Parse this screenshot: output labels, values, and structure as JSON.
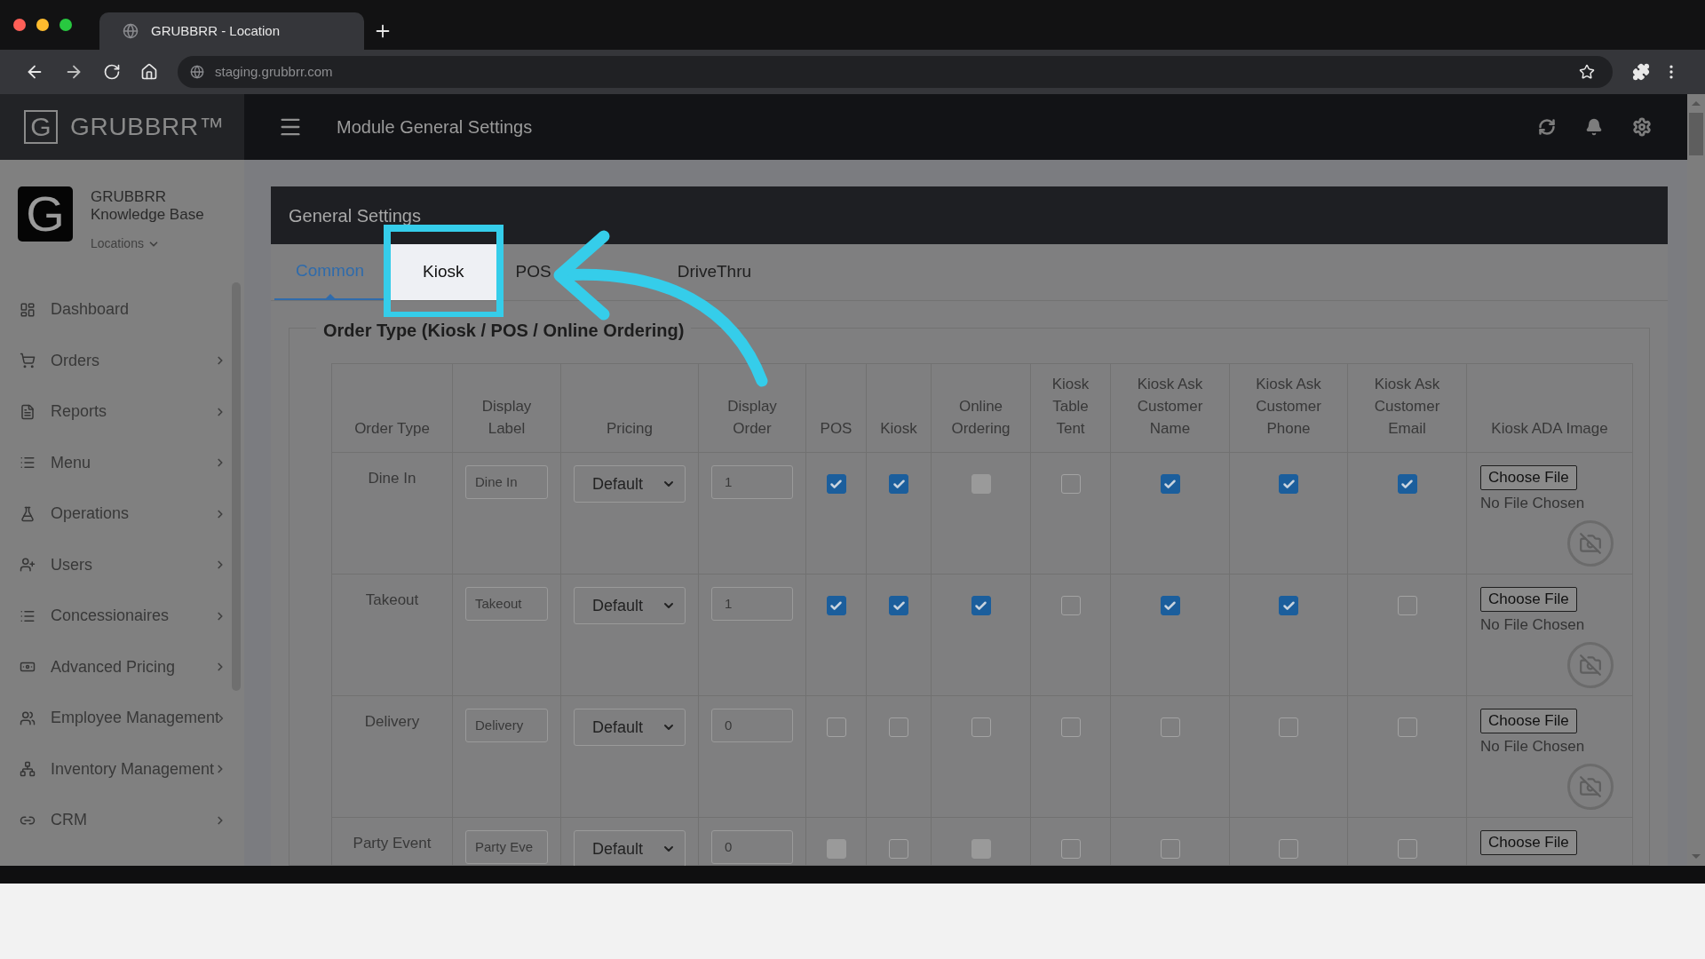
{
  "browser": {
    "tab_title": "GRUBBRR - Location",
    "url": "staging.grubbrr.com"
  },
  "header": {
    "logo_letter": "G",
    "brand": "GRUBBRR™",
    "title": "Module General Settings"
  },
  "sidebar": {
    "avatar_letter": "G",
    "org_name": "GRUBBRR",
    "org_subtitle": "Knowledge Base",
    "location_menu": "Locations",
    "items": [
      {
        "label": "Dashboard",
        "has_children": false
      },
      {
        "label": "Orders",
        "has_children": true
      },
      {
        "label": "Reports",
        "has_children": true
      },
      {
        "label": "Menu",
        "has_children": true
      },
      {
        "label": "Operations",
        "has_children": true
      },
      {
        "label": "Users",
        "has_children": true
      },
      {
        "label": "Concessionaires",
        "has_children": true
      },
      {
        "label": "Advanced Pricing",
        "has_children": true
      },
      {
        "label": "Employee Management",
        "has_children": true
      },
      {
        "label": "Inventory Management",
        "has_children": true
      },
      {
        "label": "CRM",
        "has_children": true
      }
    ]
  },
  "panel": {
    "title": "General Settings",
    "tabs": [
      {
        "label": "Common",
        "selected": true,
        "spotlight": false
      },
      {
        "label": "Kiosk",
        "selected": false,
        "spotlight": true
      },
      {
        "label": "POS",
        "selected": false,
        "spotlight": false
      },
      {
        "label": "DriveThru",
        "selected": false,
        "spotlight": false
      }
    ],
    "section_title": "Order Type (Kiosk / POS / Online Ordering)",
    "columns": [
      "Order Type",
      "Display Label",
      "Pricing",
      "Display Order",
      "POS",
      "Kiosk",
      "Online Ordering",
      "Kiosk Table Tent",
      "Kiosk Ask Customer Name",
      "Kiosk Ask Customer Phone",
      "Kiosk Ask Customer Email",
      "Kiosk ADA Image"
    ],
    "rows": [
      {
        "order_type": "Dine In",
        "display_label": "Dine In",
        "pricing": "Default",
        "display_order": "1",
        "checks": [
          {
            "checked": true,
            "disabled": false
          },
          {
            "checked": true,
            "disabled": false
          },
          {
            "checked": false,
            "disabled": true
          },
          {
            "checked": false,
            "disabled": false
          },
          {
            "checked": true,
            "disabled": false
          },
          {
            "checked": true,
            "disabled": false
          },
          {
            "checked": true,
            "disabled": false
          }
        ],
        "file_button": "Choose File",
        "file_status": "No File Chosen"
      },
      {
        "order_type": "Takeout",
        "display_label": "Takeout",
        "pricing": "Default",
        "display_order": "1",
        "checks": [
          {
            "checked": true,
            "disabled": false
          },
          {
            "checked": true,
            "disabled": false
          },
          {
            "checked": true,
            "disabled": false
          },
          {
            "checked": false,
            "disabled": false
          },
          {
            "checked": true,
            "disabled": false
          },
          {
            "checked": true,
            "disabled": false
          },
          {
            "checked": false,
            "disabled": false
          }
        ],
        "file_button": "Choose File",
        "file_status": "No File Chosen"
      },
      {
        "order_type": "Delivery",
        "display_label": "Delivery",
        "pricing": "Default",
        "display_order": "0",
        "checks": [
          {
            "checked": false,
            "disabled": false
          },
          {
            "checked": false,
            "disabled": false
          },
          {
            "checked": false,
            "disabled": false
          },
          {
            "checked": false,
            "disabled": false
          },
          {
            "checked": false,
            "disabled": false
          },
          {
            "checked": false,
            "disabled": false
          },
          {
            "checked": false,
            "disabled": false
          }
        ],
        "file_button": "Choose File",
        "file_status": "No File Chosen"
      },
      {
        "order_type": "Party Event",
        "display_label": "Party Eve",
        "pricing": "Default",
        "display_order": "0",
        "checks": [
          {
            "checked": false,
            "disabled": true
          },
          {
            "checked": false,
            "disabled": false
          },
          {
            "checked": false,
            "disabled": true
          },
          {
            "checked": false,
            "disabled": false
          },
          {
            "checked": false,
            "disabled": false
          },
          {
            "checked": false,
            "disabled": false
          },
          {
            "checked": false,
            "disabled": false
          }
        ],
        "file_button": "Choose File"
      }
    ]
  }
}
